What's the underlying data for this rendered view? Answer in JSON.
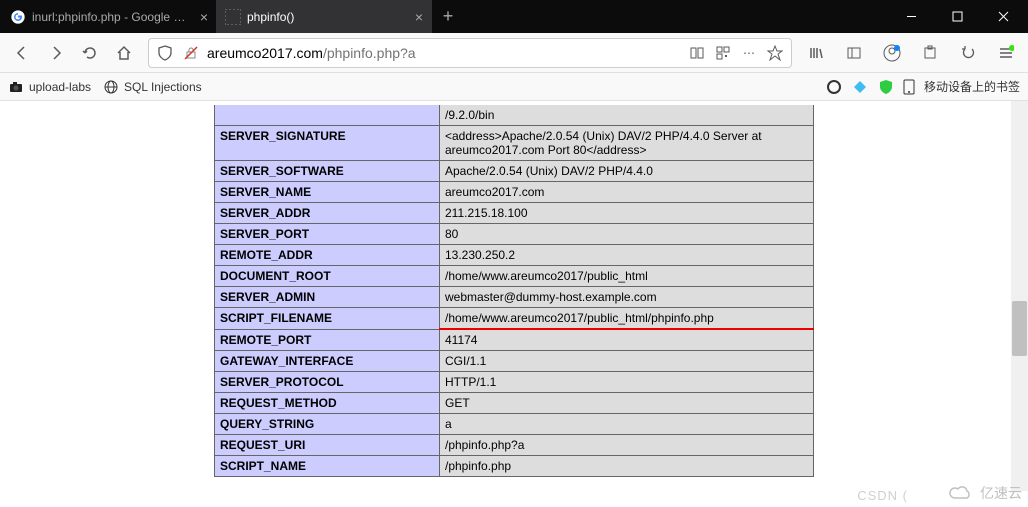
{
  "tabs": [
    {
      "title": "inurl:phpinfo.php - Google 검색",
      "favicon": "google"
    },
    {
      "title": "phpinfo()",
      "favicon": "blank"
    }
  ],
  "url_bar": {
    "domain": "areumco2017.com",
    "path": "/phpinfo.php?a"
  },
  "bookmarks": [
    {
      "label": "upload-labs",
      "icon": "camera"
    },
    {
      "label": "SQL Injections",
      "icon": "globe"
    }
  ],
  "right_bookmark_label": "移动设备上的书签",
  "php_rows": [
    {
      "key": "",
      "val": "/9.2.0/bin",
      "partial": true
    },
    {
      "key": "SERVER_SIGNATURE",
      "val": "<address>Apache/2.0.54 (Unix) DAV/2 PHP/4.4.0 Server at areumco2017.com Port 80</address>"
    },
    {
      "key": "SERVER_SOFTWARE",
      "val": "Apache/2.0.54 (Unix) DAV/2 PHP/4.4.0"
    },
    {
      "key": "SERVER_NAME",
      "val": "areumco2017.com"
    },
    {
      "key": "SERVER_ADDR",
      "val": "211.215.18.100"
    },
    {
      "key": "SERVER_PORT",
      "val": "80"
    },
    {
      "key": "REMOTE_ADDR",
      "val": "13.230.250.2"
    },
    {
      "key": "DOCUMENT_ROOT",
      "val": "/home/www.areumco2017/public_html"
    },
    {
      "key": "SERVER_ADMIN",
      "val": "webmaster@dummy-host.example.com"
    },
    {
      "key": "SCRIPT_FILENAME",
      "val": "/home/www.areumco2017/public_html/phpinfo.php",
      "underline": true
    },
    {
      "key": "REMOTE_PORT",
      "val": "41174"
    },
    {
      "key": "GATEWAY_INTERFACE",
      "val": "CGI/1.1"
    },
    {
      "key": "SERVER_PROTOCOL",
      "val": "HTTP/1.1"
    },
    {
      "key": "REQUEST_METHOD",
      "val": "GET"
    },
    {
      "key": "QUERY_STRING",
      "val": "a"
    },
    {
      "key": "REQUEST_URI",
      "val": "/phpinfo.php?a"
    },
    {
      "key": "SCRIPT_NAME",
      "val": "/phpinfo.php"
    }
  ],
  "watermarks": {
    "csdn": "CSDN (",
    "yisuyun": "亿速云"
  }
}
